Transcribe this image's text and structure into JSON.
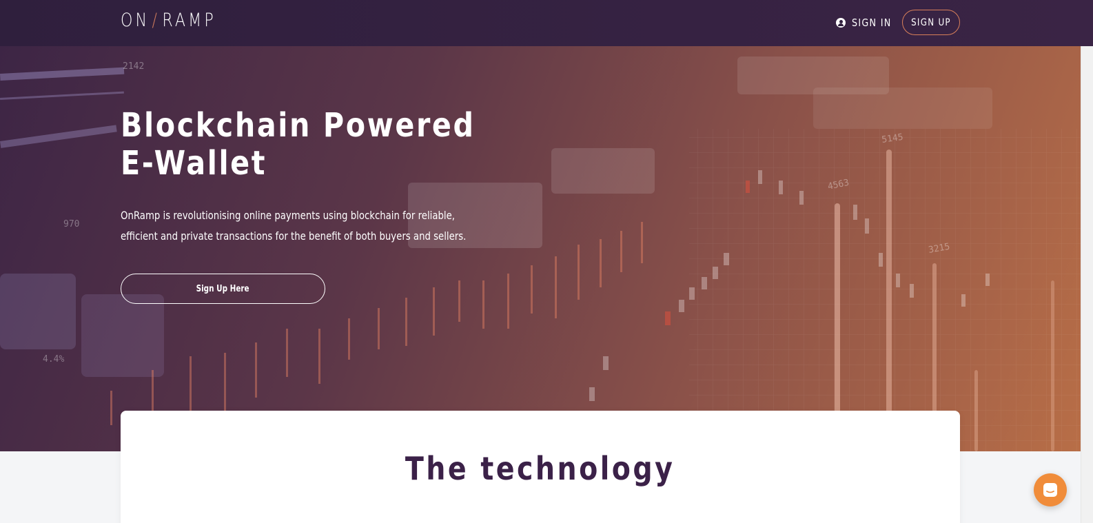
{
  "header": {
    "logo_left": "ON",
    "logo_slash": "/",
    "logo_right": "RAMP",
    "signin_label": "SIGN IN",
    "signup_label": "SIGN UP",
    "signin_icon": "user-circle-icon"
  },
  "hero": {
    "title_line1": "Blockchain Powered",
    "title_line2": "E-Wallet",
    "description": "OnRamp is revolutionising online payments using blockchain for reliable, efficient and private transactions for the benefit of both buyers and sellers.",
    "cta_label": "Sign Up Here",
    "background_numbers": [
      "2142",
      "970",
      "4563",
      "5145",
      "3215",
      "4.4%"
    ]
  },
  "technology": {
    "title": "The technology"
  },
  "chat": {
    "icon": "chat-bubble-icon"
  },
  "colors": {
    "accent": "#d9805a",
    "dark_purple": "#2f1f3d",
    "heading": "#3b2148",
    "chat": "#f08c3a"
  }
}
